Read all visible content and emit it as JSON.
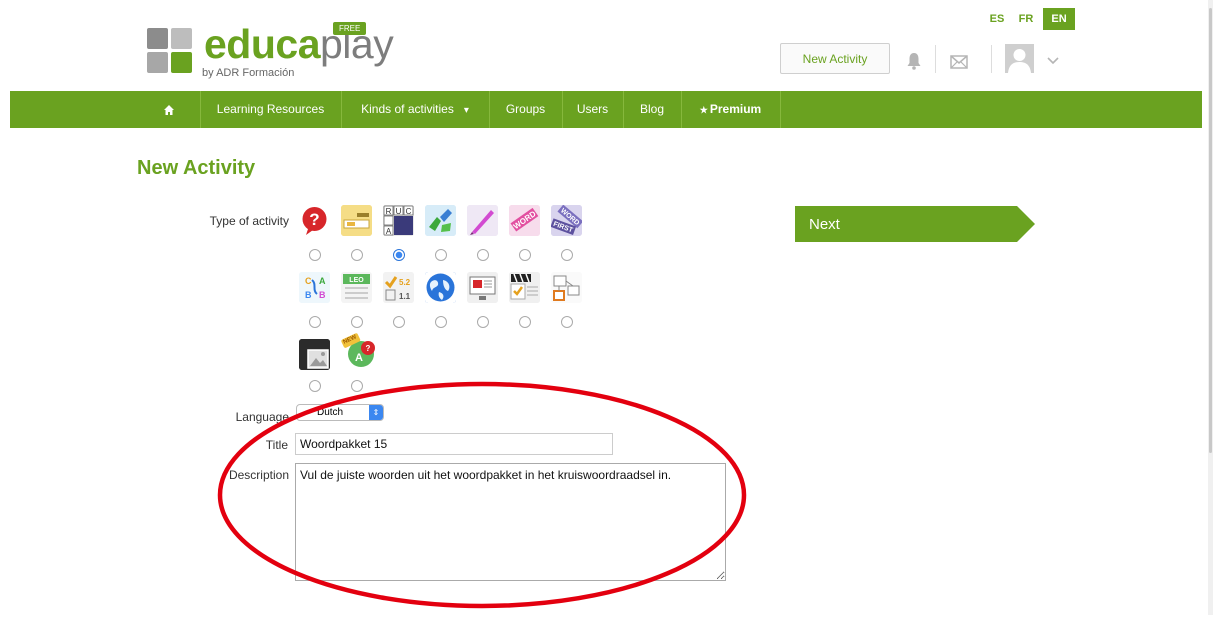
{
  "header": {
    "logo": {
      "brand_a": "educa",
      "brand_b": "play",
      "byline": "by ADR Formación",
      "badge": "FREE"
    },
    "languages": [
      "ES",
      "FR",
      "EN"
    ],
    "active_language": "EN",
    "new_activity_label": "New Activity",
    "icons": [
      "bell-icon",
      "mail-icon",
      "avatar",
      "chevron-down-icon"
    ]
  },
  "nav": {
    "items": [
      "Learning Resources",
      "Kinds of activities",
      "Groups",
      "Users",
      "Blog",
      "Premium"
    ],
    "home_icon": "home-icon",
    "dropdown_icon": "chevron-down-icon",
    "premium_icon": "star-icon"
  },
  "page": {
    "title": "New Activity"
  },
  "form": {
    "type_label": "Type of activity",
    "activity_types": [
      "quiz",
      "fill-blanks",
      "crossword",
      "relate",
      "dictation",
      "word-search",
      "scrambled-words",
      "alphabet",
      "word-columns",
      "completion-math",
      "map",
      "presentation",
      "video-quiz",
      "relate-concepts",
      "image-hotspot",
      "new-activity"
    ],
    "selected_type_index": 2,
    "new_badge": "NEW",
    "language_label": "Language",
    "language_value": "Dutch",
    "title_label": "Title",
    "title_value": "Woordpakket 15",
    "description_label": "Description",
    "description_value": "Vul de juiste woorden uit het woordpakket in het kruiswoordraadsel in."
  },
  "next_button": {
    "label": "Next"
  },
  "colors": {
    "brand_green": "#6aa220",
    "annotation_red": "#e3000f",
    "radio_blue": "#3b87f0"
  }
}
